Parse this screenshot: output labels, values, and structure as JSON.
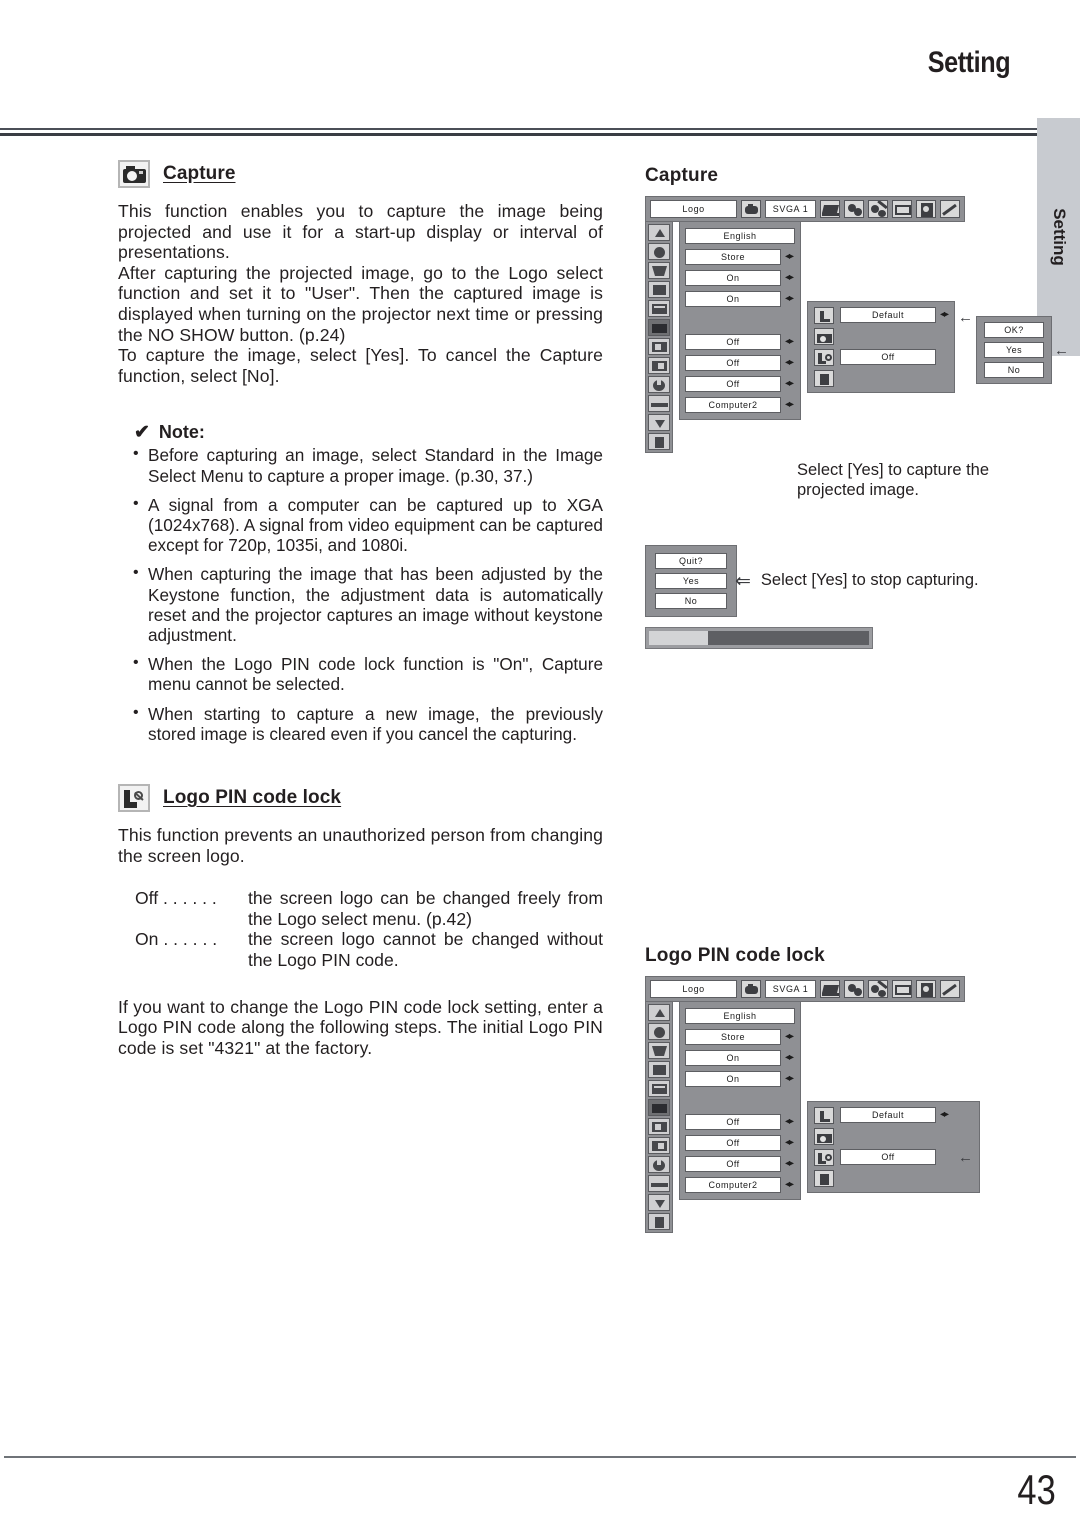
{
  "header": {
    "title": "Setting"
  },
  "side_tab": {
    "label": "Setting"
  },
  "footer": {
    "page_number": "43"
  },
  "left_column": {
    "capture_section": {
      "icon": "camera-icon",
      "heading": "Capture",
      "paragraphs": [
        "This function enables you to capture the image being projected and use it for a start-up display or interval of presentations.",
        "After capturing the projected image, go to the Logo select function and set it to \"User\".  Then the captured image is displayed when turning on the projector next time or pressing the NO SHOW button. (p.24)",
        "To capture the image, select [Yes].  To cancel the Capture function, select [No]."
      ],
      "note": {
        "check_glyph": "✔",
        "label": "Note:",
        "items": [
          "Before capturing an image, select Standard in the Image Select Menu to capture a proper image. (p.30, 37.)",
          "A signal from a computer can be captured up to XGA (1024x768).  A signal from video equipment can be captured except for 720p, 1035i, and 1080i.",
          "When capturing the image that has been adjusted by the Keystone function, the adjustment data is automatically reset and the projector captures an image without keystone adjustment.",
          "When the Logo PIN code lock function is \"On\", Capture menu cannot be selected.",
          "When starting to capture a new image, the previously stored image is cleared even if you cancel the capturing."
        ]
      }
    },
    "logo_pin_section": {
      "icon": "logo-pin-key-icon",
      "heading": "Logo PIN code lock",
      "intro": "This function prevents an unauthorized person from changing the screen logo.",
      "definitions": [
        {
          "term": "Off . . . . . .",
          "desc": "the screen logo can be changed freely from the Logo select menu. (p.42)"
        },
        {
          "term": "On . . . . . .",
          "desc": "the screen logo cannot be changed without the Logo PIN code."
        }
      ],
      "closing": "If you want to change the Logo PIN code lock setting, enter a Logo PIN code along the following steps.  The initial Logo PIN code is set \"4321\" at the factory."
    }
  },
  "right_column": {
    "capture_diagram": {
      "title": "Capture",
      "menu_bar": {
        "title_field": "Logo",
        "source_field": "SVGA 1"
      },
      "menu_values": [
        "English",
        "Store",
        "On",
        "On",
        "Off",
        "Off",
        "Off",
        "Computer2"
      ],
      "sub_panel": {
        "row1": "Default",
        "row2": "Off"
      },
      "confirm_dialog": {
        "prompt": "OK?",
        "yes": "Yes",
        "no": "No"
      },
      "caption": "Select [Yes] to capture the projected image."
    },
    "quit_dialog": {
      "prompt": "Quit?",
      "yes": "Yes",
      "no": "No",
      "caption": "Select [Yes] to stop capturing.",
      "progress_percent": 27
    },
    "logo_pin_diagram": {
      "title": "Logo PIN code lock",
      "menu_bar": {
        "title_field": "Logo",
        "source_field": "SVGA 1"
      },
      "menu_values": [
        "English",
        "Store",
        "On",
        "On",
        "Off",
        "Off",
        "Off",
        "Computer2"
      ],
      "sub_panel": {
        "row1": "Default",
        "row2": "Off"
      }
    }
  }
}
